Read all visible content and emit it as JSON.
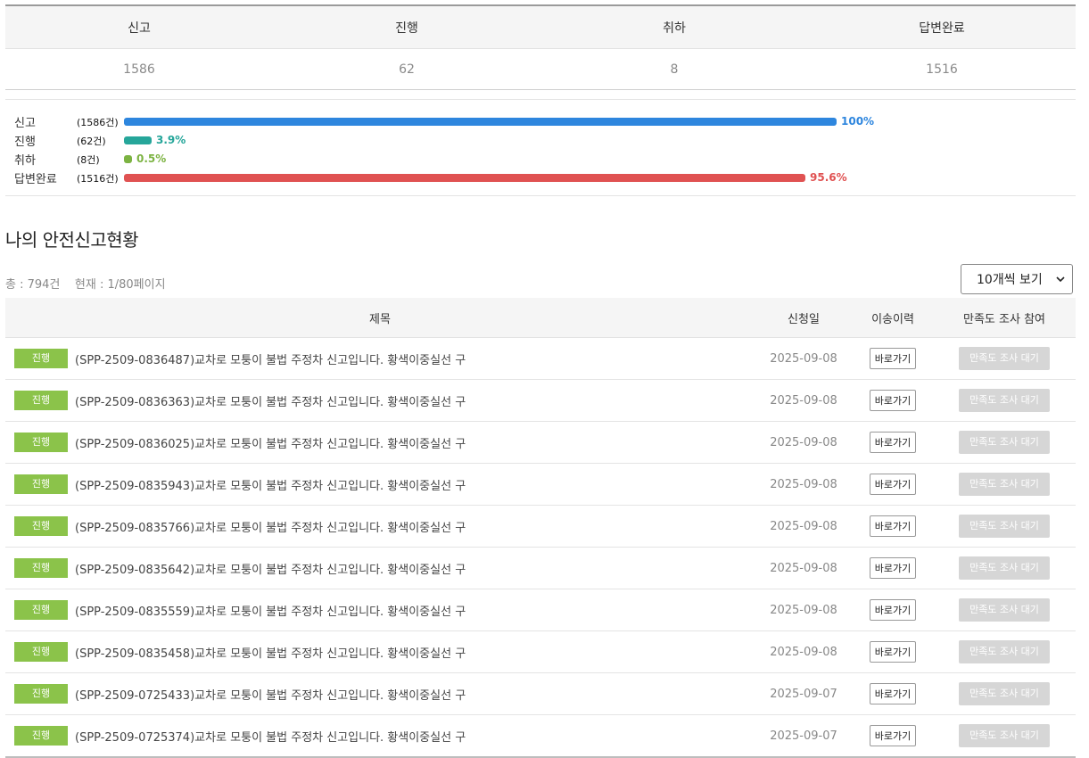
{
  "summary": {
    "headers": [
      "신고",
      "진행",
      "취하",
      "답변완료"
    ],
    "values": [
      "1586",
      "62",
      "8",
      "1516"
    ]
  },
  "bars": [
    {
      "label": "신고",
      "count": "(1586건)",
      "pct": 100,
      "pct_label": "100%",
      "color": "#2e86de"
    },
    {
      "label": "진행",
      "count": "(62건)",
      "pct": 3.9,
      "pct_label": "3.9%",
      "color": "#26a69a"
    },
    {
      "label": "취하",
      "count": "(8건)",
      "pct": 0.5,
      "pct_label": "0.5%",
      "color": "#7cb342"
    },
    {
      "label": "답변완료",
      "count": "(1516건)",
      "pct": 95.6,
      "pct_label": "95.6%",
      "color": "#e05252"
    }
  ],
  "section_title": "나의 안전신고현황",
  "list_info": {
    "total": "총 : 794건",
    "current": "현재 : 1/80페이지",
    "per_page": "10개씩 보기"
  },
  "table": {
    "headers": {
      "title": "제목",
      "date": "신청일",
      "history": "이송이력",
      "satisfaction": "만족도 조사 참여"
    },
    "rows": [
      {
        "status": "진행",
        "title": "(SPP-2509-0836487)교차로 모퉁이 불법 주정차 신고입니다. 황색이중실선 구",
        "date": "2025-09-08",
        "history": "바로가기",
        "satisfaction": "만족도 조사 대기"
      },
      {
        "status": "진행",
        "title": "(SPP-2509-0836363)교차로 모퉁이 불법 주정차 신고입니다. 황색이중실선 구",
        "date": "2025-09-08",
        "history": "바로가기",
        "satisfaction": "만족도 조사 대기"
      },
      {
        "status": "진행",
        "title": "(SPP-2509-0836025)교차로 모퉁이 불법 주정차 신고입니다. 황색이중실선 구",
        "date": "2025-09-08",
        "history": "바로가기",
        "satisfaction": "만족도 조사 대기"
      },
      {
        "status": "진행",
        "title": "(SPP-2509-0835943)교차로 모퉁이 불법 주정차 신고입니다. 황색이중실선 구",
        "date": "2025-09-08",
        "history": "바로가기",
        "satisfaction": "만족도 조사 대기"
      },
      {
        "status": "진행",
        "title": "(SPP-2509-0835766)교차로 모퉁이 불법 주정차 신고입니다. 황색이중실선 구",
        "date": "2025-09-08",
        "history": "바로가기",
        "satisfaction": "만족도 조사 대기"
      },
      {
        "status": "진행",
        "title": "(SPP-2509-0835642)교차로 모퉁이 불법 주정차 신고입니다. 황색이중실선 구",
        "date": "2025-09-08",
        "history": "바로가기",
        "satisfaction": "만족도 조사 대기"
      },
      {
        "status": "진행",
        "title": "(SPP-2509-0835559)교차로 모퉁이 불법 주정차 신고입니다. 황색이중실선 구",
        "date": "2025-09-08",
        "history": "바로가기",
        "satisfaction": "만족도 조사 대기"
      },
      {
        "status": "진행",
        "title": "(SPP-2509-0835458)교차로 모퉁이 불법 주정차 신고입니다. 황색이중실선 구",
        "date": "2025-09-08",
        "history": "바로가기",
        "satisfaction": "만족도 조사 대기"
      },
      {
        "status": "진행",
        "title": "(SPP-2509-0725433)교차로 모퉁이 불법 주정차 신고입니다. 황색이중실선 구",
        "date": "2025-09-07",
        "history": "바로가기",
        "satisfaction": "만족도 조사 대기"
      },
      {
        "status": "진행",
        "title": "(SPP-2509-0725374)교차로 모퉁이 불법 주정차 신고입니다. 황색이중실선 구",
        "date": "2025-09-07",
        "history": "바로가기",
        "satisfaction": "만족도 조사 대기"
      }
    ]
  }
}
